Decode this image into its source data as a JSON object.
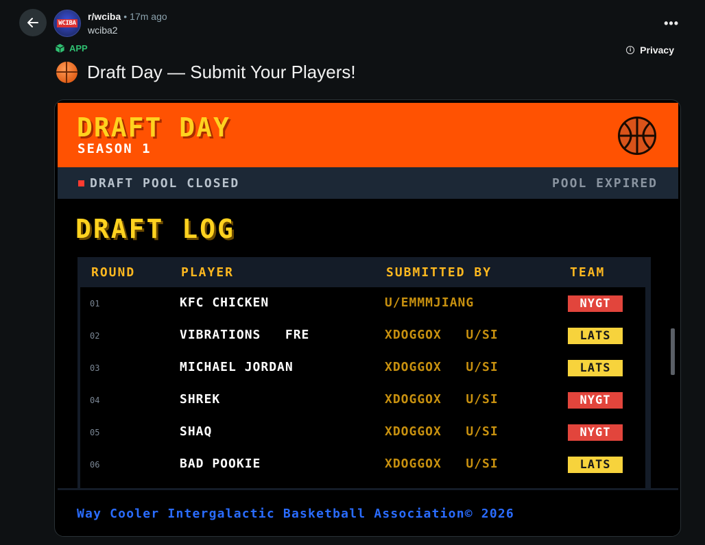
{
  "post": {
    "subreddit": "r/wciba",
    "separator": "•",
    "time": "17m ago",
    "author": "wciba2",
    "avatar_text": "WCIBA",
    "app_tag": "APP",
    "privacy": "Privacy",
    "more": "•••",
    "title": "Draft Day — Submit Your Players!"
  },
  "app": {
    "banner": {
      "title": "DRAFT DAY",
      "season": "SEASON 1"
    },
    "status": {
      "left": "DRAFT POOL CLOSED",
      "right": "POOL EXPIRED"
    },
    "log_title": "DRAFT LOG",
    "table": {
      "headers": {
        "round": "ROUND",
        "player": "PLAYER",
        "submitted_by": "SUBMITTED BY",
        "team": "TEAM"
      },
      "rows": [
        {
          "round": "01",
          "player": "KFC CHICKEN",
          "user": "U/EMMMJIANG",
          "team": "NYGT"
        },
        {
          "round": "02",
          "player": "VIBRATIONS   FRE",
          "user": "XDOGGOX   U/SI",
          "team": "LATS"
        },
        {
          "round": "03",
          "player": "MICHAEL JORDAN",
          "user": "XDOGGOX   U/SI",
          "team": "LATS"
        },
        {
          "round": "04",
          "player": "SHREK",
          "user": "XDOGGOX   U/SI",
          "team": "NYGT"
        },
        {
          "round": "05",
          "player": "SHAQ",
          "user": "XDOGGOX   U/SI",
          "team": "NYGT"
        },
        {
          "round": "06",
          "player": "BAD POOKIE",
          "user": "XDOGGOX   U/SI",
          "team": "LATS"
        }
      ]
    },
    "footer": "Way Cooler Intergalactic Basketball Association© 2026"
  },
  "colors": {
    "banner": "#ff5202",
    "title_yellow": "#ffd21f",
    "nygt": "#e2453c",
    "lats": "#f7d33c",
    "footer_blue": "#2a6cff"
  }
}
